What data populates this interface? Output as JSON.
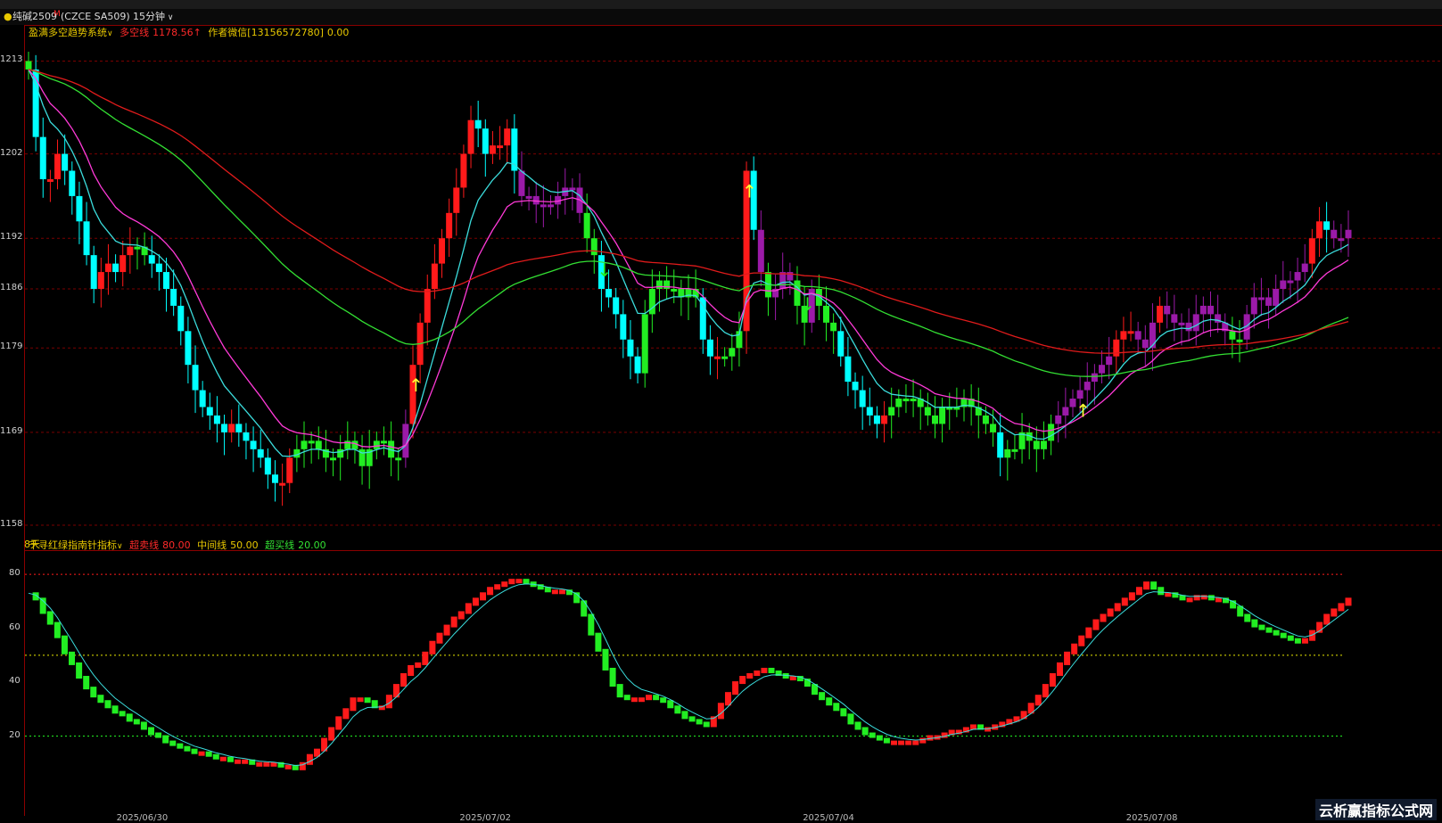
{
  "title_bar": {
    "symbol": "纯碱2509",
    "symbol_marker": "M",
    "code": "(CZCE SA509)",
    "period": "15分钟",
    "period_dropdown_icon": "chevron-down-icon"
  },
  "main_chart": {
    "indicator_name": "盈满多空趋势系统",
    "line_label": "多空线",
    "line_value": "1178.56↑",
    "author_label": "作者微信[13156572780]",
    "author_value": "0.00",
    "period_tag": "8天",
    "y_ticks": [
      "1213",
      "1202",
      "1192",
      "1186",
      "1179",
      "1169",
      "1158"
    ]
  },
  "sub_chart": {
    "indicator_name": "千寻红绿指南针指标",
    "overbought_label": "超卖线",
    "overbought_value": "80.00",
    "middle_label": "中间线",
    "middle_value": "50.00",
    "oversold_label": "超买线",
    "oversold_value": "20.00",
    "y_ticks": [
      "80",
      "60",
      "40",
      "20"
    ]
  },
  "x_axis_dates": [
    "2025/06/30",
    "2025/07/02",
    "2025/07/04",
    "2025/07/08"
  ],
  "watermark": "云析赢指标公式网",
  "colors": {
    "up": "#ff1a1a",
    "down": "#00ffff",
    "trend_up": "#9b1aa8",
    "trend_down": "#22ee22",
    "ma_cyan": "#3bdcdc",
    "ma_magenta": "#ff3ad8",
    "ma_green": "#33e033",
    "ma_red": "#e01b1b",
    "arrow_up": "#ffff33",
    "arrow_down": "#22ee22",
    "grid": "#7a0000"
  },
  "chart_data": [
    {
      "type": "candlestick",
      "title": "盈满多空趋势系统",
      "ylim": [
        1158,
        1214
      ],
      "closes": [
        1212,
        1204,
        1199,
        1199,
        1202,
        1200,
        1197,
        1194,
        1190,
        1186,
        1188,
        1189,
        1188,
        1190,
        1191,
        1191,
        1190,
        1189,
        1188,
        1186,
        1184,
        1181,
        1177,
        1174,
        1172,
        1171,
        1170,
        1169,
        1170,
        1169,
        1168,
        1167,
        1166,
        1164,
        1163,
        1163,
        1166,
        1167,
        1168,
        1168,
        1167,
        1166,
        1166,
        1167,
        1168,
        1167,
        1165,
        1167,
        1168,
        1168,
        1166,
        1166,
        1170,
        1177,
        1182,
        1186,
        1189,
        1192,
        1195,
        1198,
        1202,
        1206,
        1205,
        1202,
        1203,
        1203,
        1205,
        1200,
        1197,
        1197,
        1196,
        1196,
        1196,
        1197,
        1198,
        1198,
        1195,
        1192,
        1190,
        1186,
        1185,
        1183,
        1180,
        1178,
        1176,
        1183,
        1186,
        1187,
        1186,
        1186,
        1185,
        1186,
        1185,
        1180,
        1178,
        1178,
        1178,
        1179,
        1181,
        1200,
        1193,
        1188,
        1185,
        1186,
        1188,
        1187,
        1184,
        1182,
        1186,
        1184,
        1182,
        1181,
        1178,
        1175,
        1174,
        1172,
        1171,
        1170,
        1171,
        1172,
        1173,
        1173,
        1173,
        1172,
        1171,
        1170,
        1172,
        1172,
        1172,
        1173,
        1172,
        1171,
        1170,
        1169,
        1166,
        1167,
        1167,
        1169,
        1168,
        1167,
        1168,
        1170,
        1171,
        1172,
        1173,
        1174,
        1175,
        1176,
        1177,
        1178,
        1180,
        1181,
        1181,
        1180,
        1179,
        1182,
        1184,
        1183,
        1182,
        1182,
        1181,
        1183,
        1184,
        1183,
        1182,
        1181,
        1180,
        1180,
        1183,
        1185,
        1185,
        1184,
        1186,
        1187,
        1187,
        1188,
        1189,
        1192,
        1194,
        1193,
        1192,
        1192,
        1193
      ]
    },
    {
      "type": "line",
      "title": "千寻红绿指南针指标",
      "ylim": [
        0,
        86
      ],
      "x_labels": [
        "2025/06/30",
        "2025/07/02",
        "2025/07/04",
        "2025/07/08"
      ],
      "reference_lines": [
        80,
        50,
        20
      ],
      "values": [
        73,
        71,
        66,
        62,
        57,
        51,
        47,
        42,
        38,
        35,
        33,
        31,
        29,
        28,
        26,
        25,
        23,
        21,
        20,
        18,
        17,
        16,
        15,
        14,
        14,
        13,
        12,
        12,
        11,
        11,
        11,
        10,
        10,
        10,
        10,
        9,
        9,
        8,
        10,
        13,
        15,
        19,
        23,
        27,
        30,
        34,
        34,
        33,
        31,
        31,
        35,
        39,
        43,
        46,
        47,
        51,
        55,
        58,
        61,
        64,
        66,
        69,
        71,
        73,
        75,
        76,
        77,
        78,
        78,
        77,
        76,
        75,
        74,
        74,
        74,
        73,
        70,
        65,
        58,
        52,
        45,
        39,
        35,
        34,
        34,
        34,
        35,
        34,
        33,
        31,
        29,
        27,
        26,
        25,
        24,
        27,
        32,
        36,
        40,
        42,
        43,
        44,
        45,
        44,
        43,
        42,
        42,
        41,
        39,
        36,
        34,
        32,
        30,
        28,
        25,
        23,
        21,
        20,
        19,
        18,
        18,
        18,
        18,
        18,
        19,
        20,
        20,
        21,
        22,
        22,
        23,
        24,
        23,
        23,
        24,
        25,
        26,
        27,
        29,
        32,
        35,
        39,
        43,
        47,
        51,
        54,
        57,
        60,
        63,
        65,
        67,
        69,
        71,
        73,
        75,
        77,
        75,
        73,
        73,
        72,
        71,
        71,
        72,
        72,
        71,
        71,
        70,
        68,
        65,
        63,
        61,
        60,
        59,
        58,
        57,
        56,
        55,
        56,
        59,
        62,
        65,
        67,
        69,
        71
      ]
    }
  ]
}
